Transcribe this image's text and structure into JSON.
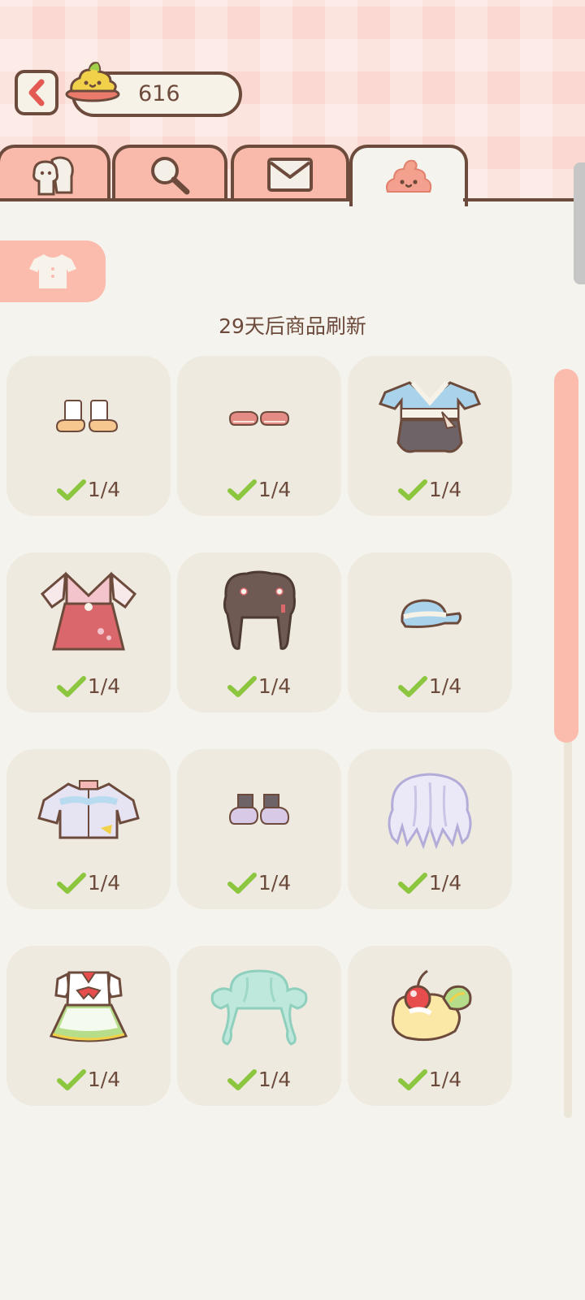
{
  "header": {
    "currency_value": "616"
  },
  "tabs": [
    {
      "icon": "friends-icon",
      "active": false
    },
    {
      "icon": "search-icon",
      "active": false
    },
    {
      "icon": "mail-icon",
      "active": false
    },
    {
      "icon": "shop-blob-icon",
      "active": true
    }
  ],
  "category": {
    "icon": "shirt-icon"
  },
  "shop": {
    "refresh_text": "29天后商品刷新",
    "items": [
      {
        "icon": "socks-shoes-icon",
        "count": "1/4"
      },
      {
        "icon": "red-shoes-icon",
        "count": "1/4"
      },
      {
        "icon": "blue-hanfu-icon",
        "count": "1/4"
      },
      {
        "icon": "red-hanfu-dress-icon",
        "count": "1/4"
      },
      {
        "icon": "brown-braids-hair-icon",
        "count": "1/4"
      },
      {
        "icon": "blue-cap-icon",
        "count": "1/4"
      },
      {
        "icon": "pastel-jacket-icon",
        "count": "1/4"
      },
      {
        "icon": "purple-sneakers-icon",
        "count": "1/4"
      },
      {
        "icon": "lavender-hair-icon",
        "count": "1/4"
      },
      {
        "icon": "melon-dress-icon",
        "count": "1/4"
      },
      {
        "icon": "mint-twintail-hair-icon",
        "count": "1/4"
      },
      {
        "icon": "cherry-melon-hat-icon",
        "count": "1/4"
      }
    ]
  },
  "colors": {
    "outline": "#6d4b3c",
    "accent": "#fbbcae",
    "check": "#8cc63f",
    "card": "#eeeae0"
  }
}
